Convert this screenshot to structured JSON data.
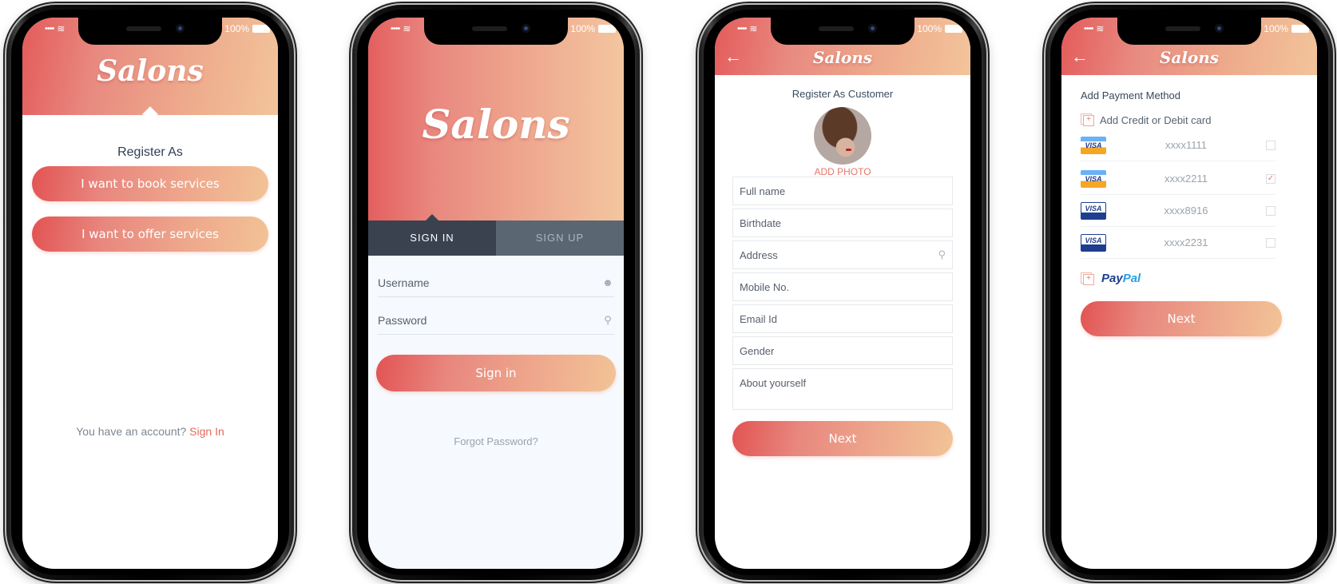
{
  "status_bar": {
    "battery": "100%",
    "signal": "••••",
    "wifi": "wifi"
  },
  "brand": {
    "name": "Salons",
    "accent": "#e66a5c",
    "gradient_start": "#e35f5f",
    "gradient_end": "#f3c69f",
    "tab_active": "#39424e",
    "tab_inactive": "#5a6672"
  },
  "screen1": {
    "title": "Register As",
    "buttons": [
      "I want to book services",
      "I want to offer services"
    ],
    "footer_text": "You have an account?",
    "footer_link": "Sign In"
  },
  "screen2": {
    "tabs": [
      {
        "label": "SIGN IN",
        "active": true
      },
      {
        "label": "SIGN UP",
        "active": false
      }
    ],
    "username_placeholder": "Username",
    "password_placeholder": "Password",
    "submit": "Sign in",
    "forgot": "Forgot Password?"
  },
  "screen3": {
    "back": "←",
    "title": "Register As Customer",
    "add_photo": "ADD PHOTO",
    "fields": [
      "Full name",
      "Birthdate",
      "Address",
      "Mobile No.",
      "Email Id",
      "Gender"
    ],
    "about": "About yourself",
    "submit": "Next"
  },
  "screen4": {
    "back": "←",
    "title": "Add Payment Method",
    "add_card": "Add Credit or Debit card",
    "cards": [
      {
        "type": "visa",
        "number": "xxxx1111",
        "checked": false,
        "mark": ""
      },
      {
        "type": "visa",
        "number": "xxxx2211",
        "checked": true,
        "mark": "✓"
      },
      {
        "type": "visa-debit",
        "number": "xxxx8916",
        "checked": false,
        "mark": ""
      },
      {
        "type": "visa-debit",
        "number": "xxxx2231",
        "checked": false,
        "mark": ""
      }
    ],
    "visa_label": "VISA",
    "paypal_pay": "Pay",
    "paypal_pal": "Pal",
    "submit": "Next"
  }
}
